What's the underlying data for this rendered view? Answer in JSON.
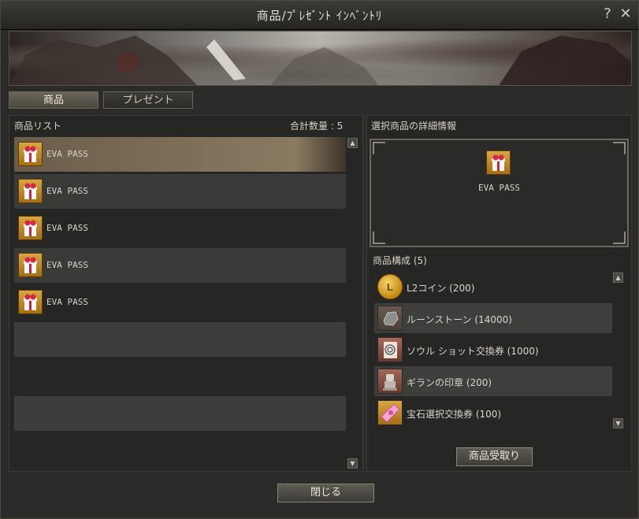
{
  "window": {
    "title": "商品/ﾌﾟﾚｾﾞﾝﾄ ｲﾝﾍﾞﾝﾄﾘ",
    "help": "?",
    "close": "✕"
  },
  "tabs": {
    "products": "商品",
    "present": "プレゼント"
  },
  "list": {
    "header": "商品リスト",
    "count_label": "合計数量 : 5",
    "items": [
      {
        "label": "EVA PASS"
      },
      {
        "label": "EVA PASS"
      },
      {
        "label": "EVA PASS"
      },
      {
        "label": "EVA PASS"
      },
      {
        "label": "EVA PASS"
      }
    ]
  },
  "detail": {
    "header": "選択商品の詳細情報",
    "selected_name": "EVA PASS",
    "composition_header": "商品構成 (5)",
    "components": [
      {
        "label": "L2コイン (200)",
        "icon": "l2-coin-icon"
      },
      {
        "label": "ルーンストーン (14000)",
        "icon": "rune-stone-icon"
      },
      {
        "label": "ソウル ショット交換券 (1000)",
        "icon": "soulshot-ticket-icon"
      },
      {
        "label": "ギランの印章 (200)",
        "icon": "giran-seal-icon"
      },
      {
        "label": "宝石選択交換券 (100)",
        "icon": "gem-ticket-icon"
      }
    ],
    "receive_button": "商品受取り"
  },
  "footer": {
    "close_button": "閉じる"
  }
}
